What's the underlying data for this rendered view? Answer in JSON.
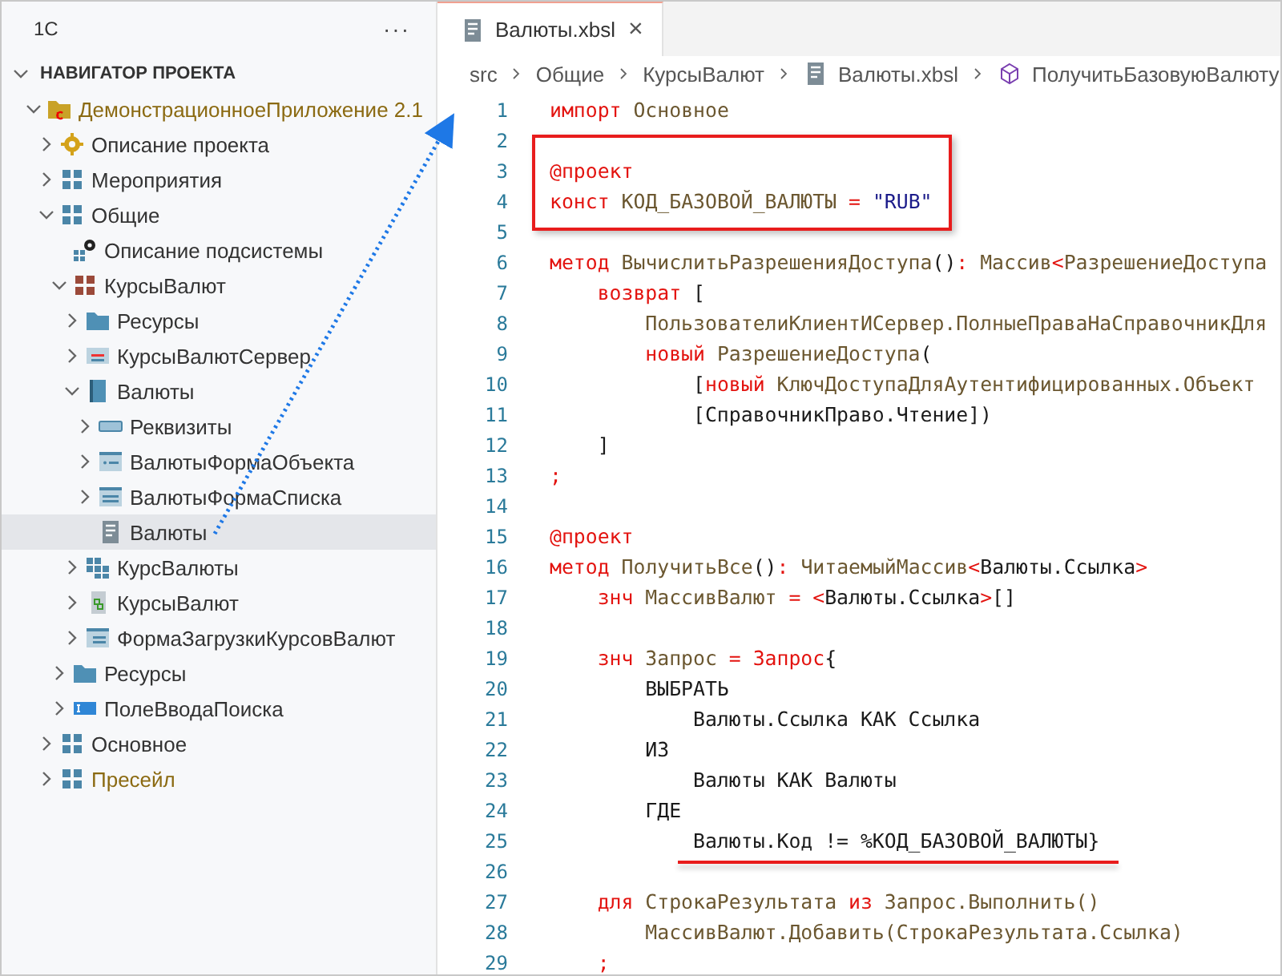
{
  "sidebar": {
    "title": "1C",
    "more": "···",
    "section": {
      "title": "НАВИГАТОР ПРОЕКТА",
      "expanded": true
    },
    "tree": [
      {
        "label": "ДемонстрационноеПриложение 2.1",
        "kind": "project",
        "expanded": true,
        "modified": true,
        "selected": false,
        "children": [
          {
            "label": "Описание проекта",
            "kind": "gear",
            "expanded": false,
            "modified": false,
            "selected": false
          },
          {
            "label": "Мероприятия",
            "kind": "subsystem",
            "expanded": false,
            "modified": false,
            "selected": false
          },
          {
            "label": "Общие",
            "kind": "subsystem",
            "expanded": true,
            "modified": false,
            "selected": false,
            "children": [
              {
                "label": "Описание подсистемы",
                "kind": "settings",
                "modified": false,
                "selected": false
              },
              {
                "label": "КурсыВалют",
                "kind": "subsystem-alt",
                "expanded": true,
                "modified": false,
                "selected": false,
                "children": [
                  {
                    "label": "Ресурсы",
                    "kind": "folder",
                    "expanded": false,
                    "modified": false,
                    "selected": false
                  },
                  {
                    "label": "КурсыВалютСервер",
                    "kind": "module",
                    "expanded": false,
                    "modified": false,
                    "selected": false
                  },
                  {
                    "label": "Валюты",
                    "kind": "catalog",
                    "expanded": true,
                    "modified": false,
                    "selected": false,
                    "children": [
                      {
                        "label": "Реквизиты",
                        "kind": "attributes",
                        "expanded": false,
                        "modified": false,
                        "selected": false
                      },
                      {
                        "label": "ВалютыФормаОбъекта",
                        "kind": "form-object",
                        "expanded": false,
                        "modified": false,
                        "selected": false
                      },
                      {
                        "label": "ВалютыФормаСписка",
                        "kind": "form-list",
                        "expanded": false,
                        "modified": false,
                        "selected": false
                      },
                      {
                        "label": "Валюты",
                        "kind": "file",
                        "modified": false,
                        "selected": true
                      }
                    ]
                  },
                  {
                    "label": "КурсВалюты",
                    "kind": "register",
                    "expanded": false,
                    "modified": false,
                    "selected": false
                  },
                  {
                    "label": "КурсыВалют",
                    "kind": "report",
                    "expanded": false,
                    "modified": false,
                    "selected": false
                  },
                  {
                    "label": "ФормаЗагрузкиКурсовВалют",
                    "kind": "form",
                    "expanded": false,
                    "modified": false,
                    "selected": false
                  }
                ]
              },
              {
                "label": "Ресурсы",
                "kind": "folder",
                "expanded": false,
                "modified": false,
                "selected": false
              },
              {
                "label": "ПолеВводаПоиска",
                "kind": "input",
                "expanded": false,
                "modified": false,
                "selected": false
              }
            ]
          },
          {
            "label": "Основное",
            "kind": "subsystem",
            "expanded": false,
            "modified": false,
            "selected": false
          },
          {
            "label": "Пресейл",
            "kind": "subsystem",
            "expanded": false,
            "modified": true,
            "selected": false
          }
        ]
      }
    ]
  },
  "tabs": [
    {
      "label": "Валюты.xbsl",
      "close": "×",
      "selected": true
    }
  ],
  "breadcrumbs": [
    {
      "label": "src",
      "kind": "folder"
    },
    {
      "label": "Общие",
      "kind": "folder"
    },
    {
      "label": "КурсыВалют",
      "kind": "folder"
    },
    {
      "label": "Валюты.xbsl",
      "kind": "file"
    },
    {
      "label": "ПолучитьБазовуюВалюту",
      "kind": "method"
    }
  ],
  "code": [
    {
      "n": "1",
      "tokens": [
        {
          "kind": "kw",
          "text": "импорт"
        },
        {
          "kind": "id",
          "text": " Основное"
        }
      ]
    },
    {
      "n": "2"
    },
    {
      "n": "3",
      "tokens": [
        {
          "kind": "kw",
          "text": "@проект"
        }
      ]
    },
    {
      "n": "4",
      "tokens": [
        {
          "kind": "kw",
          "text": "конст"
        },
        {
          "kind": "id",
          "text": " КОД_БАЗОВОЙ_ВАЛЮТЫ"
        },
        {
          "kind": "kw",
          "text": " ="
        },
        {
          "kind": "str",
          "text": " \"RUB\""
        }
      ]
    },
    {
      "n": "5"
    },
    {
      "n": "6",
      "tokens": [
        {
          "kind": "kw",
          "text": "метод"
        },
        {
          "kind": "id",
          "text": " ВычислитьРазрешенияДоступа"
        },
        {
          "kind": "plain",
          "text": "()"
        },
        {
          "kind": "kw",
          "text": ":"
        },
        {
          "kind": "id",
          "text": " Массив"
        },
        {
          "kind": "kw",
          "text": "<"
        },
        {
          "kind": "id",
          "text": "РазрешениеДоступа"
        }
      ]
    },
    {
      "n": "7",
      "tokens": [
        {
          "kind": "kw",
          "text": "    возврат"
        },
        {
          "kind": "plain",
          "text": " ["
        }
      ]
    },
    {
      "n": "8",
      "tokens": [
        {
          "kind": "id",
          "text": "        ПользователиКлиентИСервер.ПолныеПраваНаСправочникДля"
        }
      ]
    },
    {
      "n": "9",
      "tokens": [
        {
          "kind": "kw",
          "text": "        новый"
        },
        {
          "kind": "id",
          "text": " РазрешениеДоступа"
        },
        {
          "kind": "plain",
          "text": "("
        }
      ]
    },
    {
      "n": "10",
      "tokens": [
        {
          "kind": "plain",
          "text": "            ["
        },
        {
          "kind": "kw",
          "text": "новый"
        },
        {
          "kind": "id",
          "text": " КлючДоступаДляАутентифицированных.Объект"
        }
      ]
    },
    {
      "n": "11",
      "tokens": [
        {
          "kind": "plain",
          "text": "            [СправочникПраво.Чтение])"
        }
      ]
    },
    {
      "n": "12",
      "tokens": [
        {
          "kind": "plain",
          "text": "    ]"
        }
      ]
    },
    {
      "n": "13",
      "tokens": [
        {
          "kind": "kw",
          "text": ";"
        }
      ]
    },
    {
      "n": "14"
    },
    {
      "n": "15",
      "tokens": [
        {
          "kind": "kw",
          "text": "@проект"
        }
      ]
    },
    {
      "n": "16",
      "tokens": [
        {
          "kind": "kw",
          "text": "метод"
        },
        {
          "kind": "id",
          "text": " ПолучитьВсе"
        },
        {
          "kind": "plain",
          "text": "()"
        },
        {
          "kind": "kw",
          "text": ":"
        },
        {
          "kind": "id",
          "text": " ЧитаемыйМассив"
        },
        {
          "kind": "kw",
          "text": "<"
        },
        {
          "kind": "plain",
          "text": "Валюты.Ссылка"
        },
        {
          "kind": "kw",
          "text": ">"
        }
      ]
    },
    {
      "n": "17",
      "tokens": [
        {
          "kind": "kw",
          "text": "    знч"
        },
        {
          "kind": "id",
          "text": " МассивВалют"
        },
        {
          "kind": "kw",
          "text": " = <"
        },
        {
          "kind": "plain",
          "text": "Валюты.Ссылка"
        },
        {
          "kind": "kw",
          "text": ">"
        },
        {
          "kind": "plain",
          "text": "[]"
        }
      ]
    },
    {
      "n": "18"
    },
    {
      "n": "19",
      "tokens": [
        {
          "kind": "kw",
          "text": "    знч"
        },
        {
          "kind": "id",
          "text": " Запрос"
        },
        {
          "kind": "kw",
          "text": " = Запрос"
        },
        {
          "kind": "plain",
          "text": "{"
        }
      ]
    },
    {
      "n": "20",
      "tokens": [
        {
          "kind": "plain",
          "text": "        ВЫБРАТЬ"
        }
      ]
    },
    {
      "n": "21",
      "tokens": [
        {
          "kind": "plain",
          "text": "            Валюты.Ссылка КАК Ссылка"
        }
      ]
    },
    {
      "n": "22",
      "tokens": [
        {
          "kind": "plain",
          "text": "        ИЗ"
        }
      ]
    },
    {
      "n": "23",
      "tokens": [
        {
          "kind": "plain",
          "text": "            Валюты КАК Валюты"
        }
      ]
    },
    {
      "n": "24",
      "tokens": [
        {
          "kind": "plain",
          "text": "        ГДЕ"
        }
      ]
    },
    {
      "n": "25",
      "tokens": [
        {
          "kind": "plain",
          "text": "            Валюты.Код != %КОД_БАЗОВОЙ_ВАЛЮТЫ}"
        }
      ]
    },
    {
      "n": "26"
    },
    {
      "n": "27",
      "tokens": [
        {
          "kind": "kw",
          "text": "    для"
        },
        {
          "kind": "id",
          "text": " СтрокаРезультата"
        },
        {
          "kind": "kw",
          "text": " из"
        },
        {
          "kind": "id",
          "text": " Запрос.Выполнить()"
        }
      ]
    },
    {
      "n": "28",
      "tokens": [
        {
          "kind": "id",
          "text": "        МассивВалют.Добавить(СтрокаРезультата.Ссылка)"
        }
      ]
    },
    {
      "n": "29",
      "tokens": [
        {
          "kind": "kw",
          "text": "    ;"
        }
      ]
    }
  ]
}
